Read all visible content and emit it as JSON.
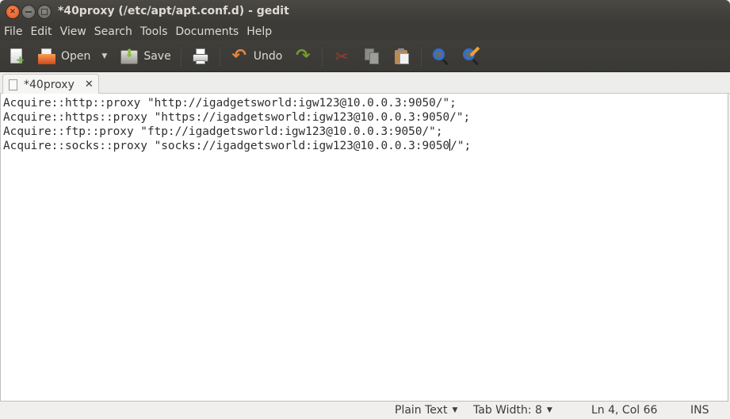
{
  "window": {
    "title": "*40proxy (/etc/apt/apt.conf.d) - gedit",
    "controls": {
      "close": "×",
      "minimize": "",
      "maximize": ""
    }
  },
  "menubar": {
    "items": [
      "File",
      "Edit",
      "View",
      "Search",
      "Tools",
      "Documents",
      "Help"
    ]
  },
  "toolbar": {
    "new_icon": "new-document-icon",
    "open_label": "Open",
    "open_dropdown": "▼",
    "save_label": "Save",
    "print_icon": "print-icon",
    "undo_label": "Undo",
    "redo_icon": "redo-icon",
    "undo_glyph": "↶",
    "redo_glyph": "↷",
    "cut_glyph": "✂",
    "copy_icon": "copy-icon",
    "paste_icon": "paste-icon",
    "find_icon": "find-icon",
    "replace_icon": "find-replace-icon"
  },
  "tabs": [
    {
      "label": "*40proxy",
      "close": "✕",
      "active": true
    }
  ],
  "editor": {
    "lines": [
      "Acquire::http::proxy \"http://igadgetsworld:igw123@10.0.0.3:9050/\";",
      "Acquire::https::proxy \"https://igadgetsworld:igw123@10.0.0.3:9050/\";",
      "Acquire::ftp::proxy \"ftp://igadgetsworld:igw123@10.0.0.3:9050/\";",
      "Acquire::socks::proxy \"socks://igadgetsworld:igw123@10.0.0.3:9050"
    ],
    "line4_after_caret": "/\";",
    "cursor": {
      "line": 4,
      "col": 66
    }
  },
  "statusbar": {
    "language": "Plain Text",
    "tab_width": "Tab Width: 8",
    "position": "Ln 4, Col 66",
    "mode": "INS",
    "dropdown_glyph": "▼"
  }
}
